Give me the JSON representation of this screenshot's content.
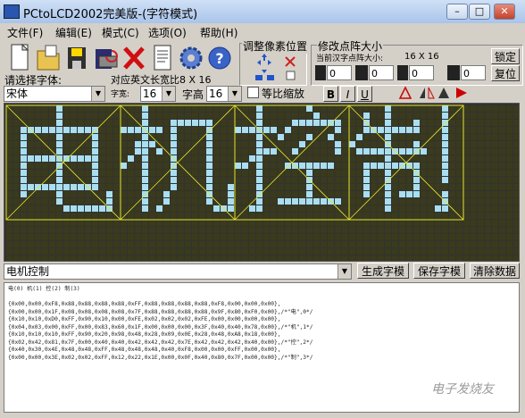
{
  "window": {
    "title": "PCtoLCD2002完美版-(字符模式)"
  },
  "menu": [
    "文件(F)",
    "编辑(E)",
    "模式(C)",
    "选项(O)",
    "帮助(H)"
  ],
  "toolbar": {
    "font_label": "请选择字体:",
    "font_value": "宋体",
    "size_hint": "对应英文长宽比8 X 16"
  },
  "pixel_adjust": {
    "label": "调整像素位置"
  },
  "dot_size": {
    "label": "修改点阵大小",
    "current_label": "当前汉字点阵大小:",
    "current_value": "16 X 16",
    "lock": "锁定",
    "reset": "复位",
    "spin_values": [
      "0",
      "0",
      "0",
      "0"
    ]
  },
  "font_size": {
    "width_label": "字宽:",
    "width_value": "16",
    "height_label": "字高",
    "height_value": "16",
    "scale_label": "等比缩放"
  },
  "format_buttons": [
    "B",
    "I",
    "U"
  ],
  "input": {
    "text": "电机控制"
  },
  "actions": {
    "generate": "生成字模",
    "save": "保存字模",
    "clear": "清除数据"
  },
  "output": {
    "header": "电(0) 机(1) 控(2) 制(3)",
    "lines": [
      "{0x00,0x00,0xF8,0x88,0x88,0x88,0x88,0xFF,0x88,0x88,0x88,0x88,0xF8,0x00,0x00,0x00},",
      "{0x00,0x00,0x1F,0x08,0x08,0x08,0x08,0x7F,0x88,0x88,0x88,0x88,0x9F,0x80,0xF0,0x00},/*\"电\",0*/",
      "{0x10,0x10,0xD0,0xFF,0x90,0x10,0x00,0xFE,0x02,0x02,0x02,0xFE,0x00,0x00,0x00,0x00},",
      "{0x04,0x03,0x00,0xFF,0x00,0x83,0x60,0x1F,0x00,0x00,0x00,0x3F,0x40,0x40,0x78,0x00},/*\"机\",1*/",
      "{0x10,0x10,0x10,0xFF,0x90,0x20,0x98,0x48,0x28,0x09,0x0E,0x28,0x48,0xA8,0x18,0x00},",
      "{0x02,0x42,0x81,0x7F,0x00,0x40,0x40,0x42,0x42,0x42,0x7E,0x42,0x42,0x42,0x40,0x00},/*\"控\",2*/",
      "{0x40,0x30,0x4E,0x48,0x48,0xFF,0x48,0x48,0x48,0x40,0xF8,0x00,0x00,0xFF,0x00,0x00},",
      "{0x00,0x00,0x3E,0x02,0x02,0xFF,0x12,0x22,0x1E,0x00,0x0F,0x40,0x80,0x7F,0x00,0x00},/*\"制\",3*/"
    ]
  },
  "watermark": "电子发烧友",
  "glyph_rows": {
    "g0": [
      "0000000100000000",
      "0000000100000000",
      "0000000100000000",
      "0011111111111000",
      "0010000100001000",
      "0010000100001000",
      "0010000100001000",
      "0011111111111000",
      "0010000100001000",
      "0010000100001000",
      "0010000100001000",
      "0011111111111000",
      "0010000100000010",
      "0000000100000010",
      "0000000011111110",
      "0000000000000000"
    ],
    "g1": [
      "0001000000000000",
      "0001000000000000",
      "0001000111111000",
      "1111110100001000",
      "0001000100001000",
      "0011100100001000",
      "0011010100001000",
      "0101000100001000",
      "1001000100001000",
      "0001000100001000",
      "0001000100001000",
      "0001000100001001",
      "0001001000001001",
      "0001001000001001",
      "0001010000000111",
      "0000000000000000"
    ],
    "g2": [
      "0001000000100000",
      "0001000000010000",
      "0001000011111110",
      "1111110100000010",
      "0001001000100100",
      "0001000001000010",
      "0001110010000010",
      "0011000000000000",
      "1101000111111100",
      "0001000000100000",
      "0001000000100000",
      "0001000000100000",
      "0001000000100000",
      "0001001111111110",
      "0011000000000000",
      "0000000000000000"
    ],
    "g3": [
      "0000010000000100",
      "0010010000000100",
      "0010010001000100",
      "0011111111000100",
      "0100010000000100",
      "1000010001000100",
      "0111111111100100",
      "0000010000000100",
      "0011111111000100",
      "0010010001000100",
      "0010010001000100",
      "0010010001000000",
      "0010010111000100",
      "0000010000000100",
      "0000010000001100",
      "0000000000000000"
    ]
  }
}
